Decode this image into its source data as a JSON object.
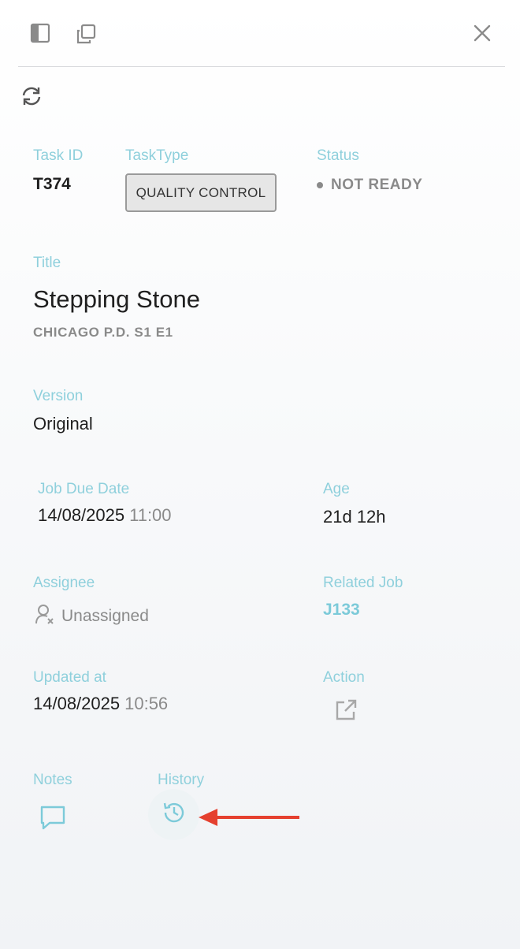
{
  "toolbar": {
    "icons": [
      "sidebar-panel-icon",
      "copy-icon",
      "close-icon"
    ]
  },
  "refresh_icon": "refresh-icon",
  "task_id": {
    "label": "Task ID",
    "value": "T374"
  },
  "task_type": {
    "label": "TaskType",
    "value": "QUALITY CONTROL"
  },
  "status": {
    "label": "Status",
    "value": "NOT READY",
    "color": "#8a8a8a"
  },
  "title": {
    "label": "Title",
    "value": "Stepping Stone",
    "subtitle": "CHICAGO P.D. S1 E1"
  },
  "version": {
    "label": "Version",
    "value": "Original"
  },
  "job_due_date": {
    "label": "Job Due Date",
    "date": "14/08/2025",
    "time": "11:00"
  },
  "age": {
    "label": "Age",
    "value": "21d 12h"
  },
  "assignee": {
    "label": "Assignee",
    "value": "Unassigned",
    "icon": "unassigned-user-icon"
  },
  "related_job": {
    "label": "Related Job",
    "value": "J133"
  },
  "updated_at": {
    "label": "Updated at",
    "date": "14/08/2025",
    "time": "10:56"
  },
  "action": {
    "label": "Action",
    "icon": "open-external-icon"
  },
  "notes": {
    "label": "Notes",
    "icon": "comment-icon"
  },
  "history": {
    "label": "History",
    "icon": "history-icon"
  },
  "annotation": {
    "type": "arrow",
    "color": "#e5402f",
    "points_to": "history-button"
  },
  "colors": {
    "accent": "#8fd0dc",
    "link": "#7ccad9",
    "text": "#1f1f1f",
    "muted": "#8a8a8a"
  }
}
